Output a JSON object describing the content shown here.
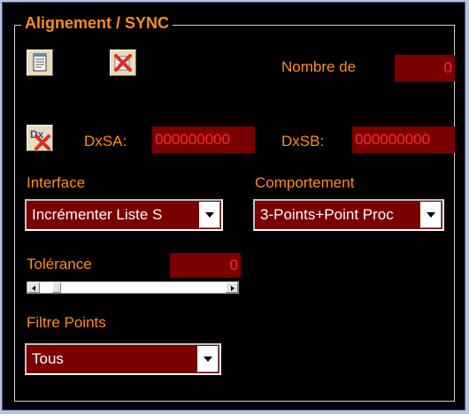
{
  "group": {
    "title": "Alignement / SYNC"
  },
  "toolbar": {
    "notepad_icon": "notepad-icon",
    "delete_icon": "delete-icon",
    "dx_delete_icon": "dx-delete-icon",
    "dx_text": "Dx"
  },
  "nombre": {
    "label": "Nombre de",
    "value": "0"
  },
  "dxsa": {
    "label": "DxSA:",
    "value": "000000000"
  },
  "dxsb": {
    "label": "DxSB:",
    "value": "000000000"
  },
  "interface": {
    "label": "Interface",
    "selected": "Incrémenter Liste S"
  },
  "comportement": {
    "label": "Comportement",
    "selected": "3-Points+Point Proc"
  },
  "tolerance": {
    "label": "Tolérance",
    "value": "0",
    "slider_fraction": 0.03
  },
  "filtre": {
    "label": "Filtre Points",
    "selected": "Tous"
  },
  "colors": {
    "accent": "#ff8c1a",
    "field_bg": "#7a0000",
    "field_text": "#ff2a2a",
    "panel_bg": "#000000"
  }
}
